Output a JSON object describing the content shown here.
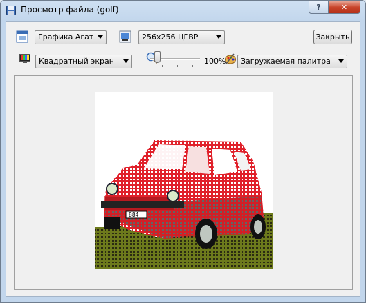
{
  "window": {
    "title": "Просмотр файла (golf)"
  },
  "titlebar": {
    "help_label": "?",
    "close_label": "✕"
  },
  "toolbar": {
    "graphics_mode": "Графика Агат",
    "resolution": "256x256 ЦГВР",
    "close_label": "Закрыть",
    "screen_mode": "Квадратный экран",
    "zoom_percent": "100%",
    "palette": "Загружаемая палитра",
    "zoom_level": 0.1
  },
  "icons": {
    "app": "floppy-disk-icon",
    "graphics": "window-icon",
    "resolution": "image-icon",
    "screen": "monitor-icon",
    "zoom": "magnifier-icon",
    "palette": "paint-palette-icon"
  }
}
